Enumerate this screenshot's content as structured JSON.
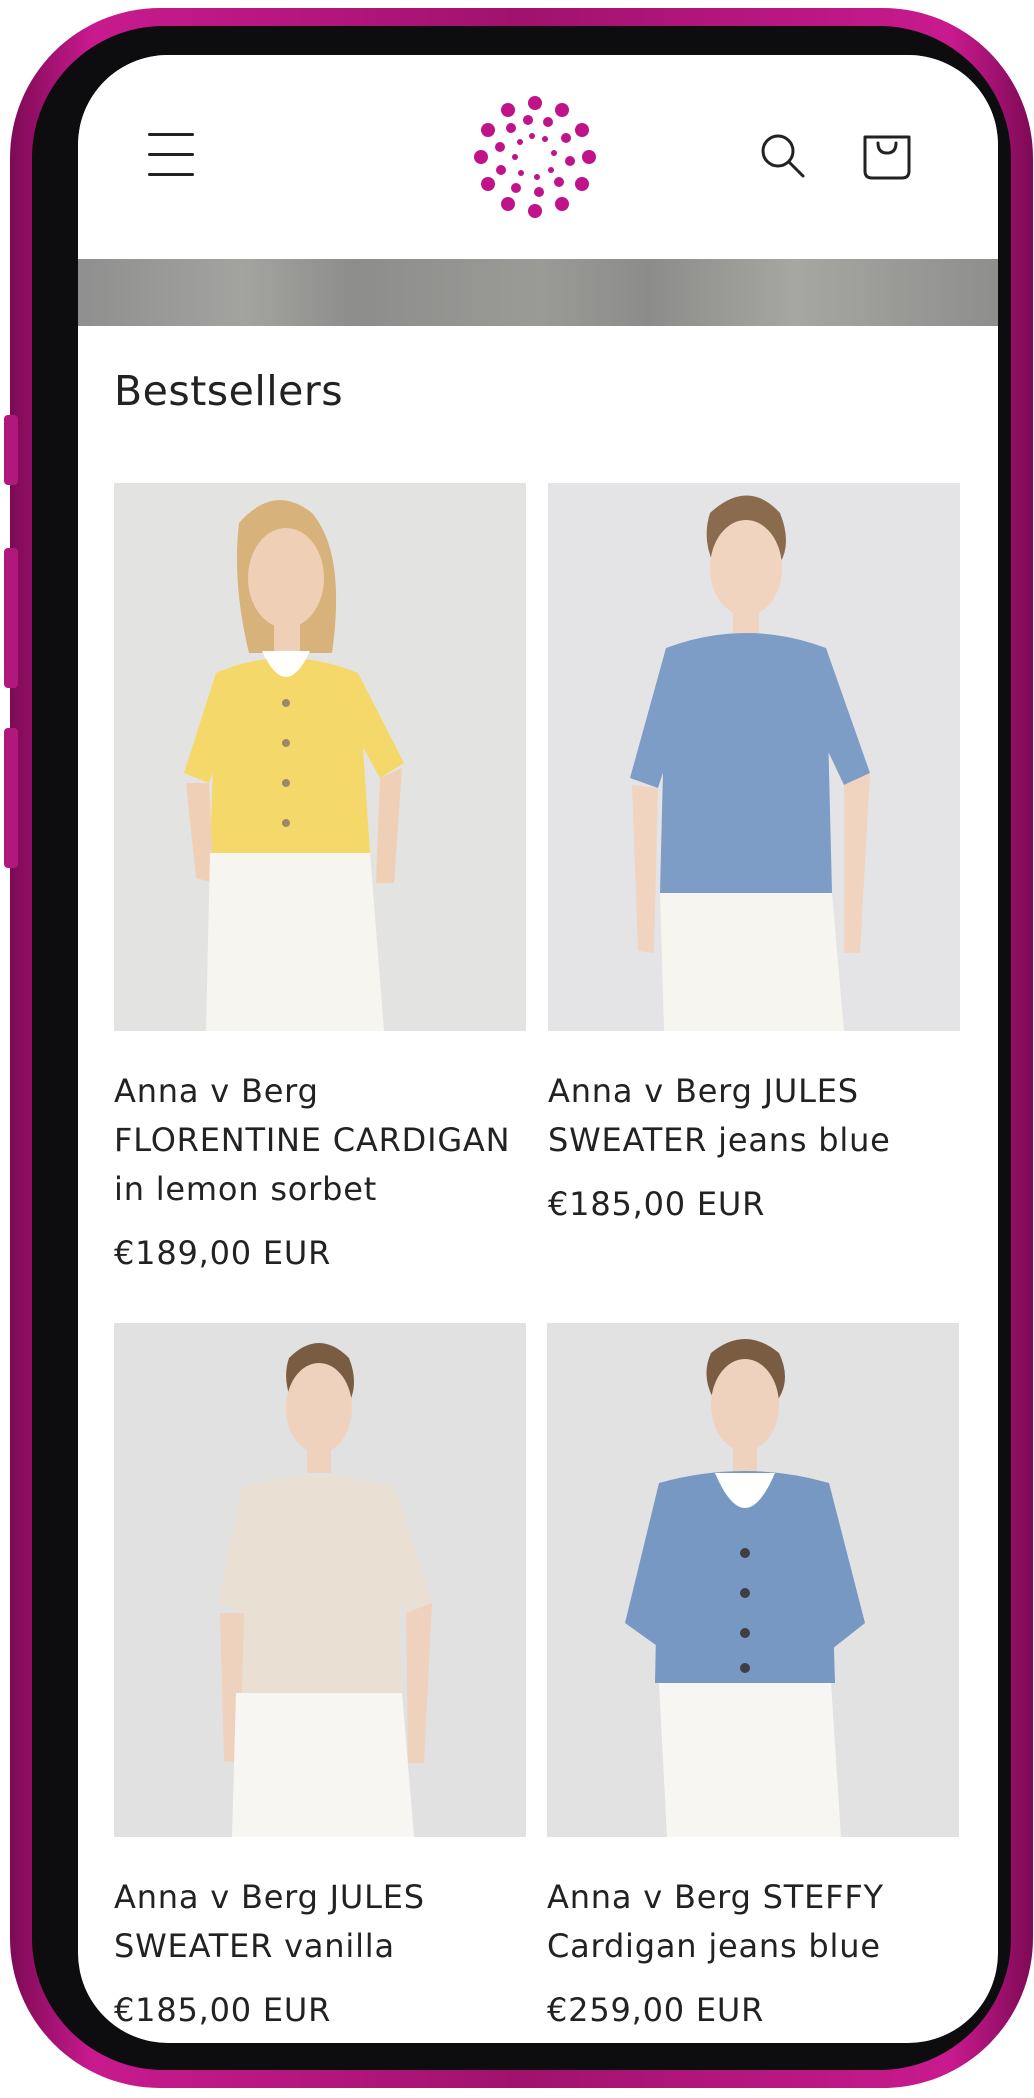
{
  "header": {
    "menu_icon": "hamburger-menu-icon",
    "logo": "dot-circle-logo",
    "search_icon": "search-icon",
    "cart_icon": "shopping-bag-icon"
  },
  "section": {
    "title": "Bestsellers"
  },
  "products": [
    {
      "name": "Anna v Berg FLORENTINE CARDIGAN in lemon sorbet",
      "price": "€189,00 EUR",
      "garment_color": "#f5d86a"
    },
    {
      "name": "Anna v Berg JULES SWEATER jeans blue",
      "price": "€185,00 EUR",
      "garment_color": "#7d9cc6"
    },
    {
      "name": "Anna v Berg JULES SWEATER vanilla",
      "price": "€185,00 EUR",
      "garment_color": "#e9dfd2"
    },
    {
      "name": "Anna v Berg STEFFY Cardigan jeans blue",
      "price": "€259,00 EUR",
      "garment_color": "#7898c4"
    }
  ],
  "colors": {
    "brand": "#c0138a",
    "frame": "#b0187e",
    "text": "#222222"
  }
}
